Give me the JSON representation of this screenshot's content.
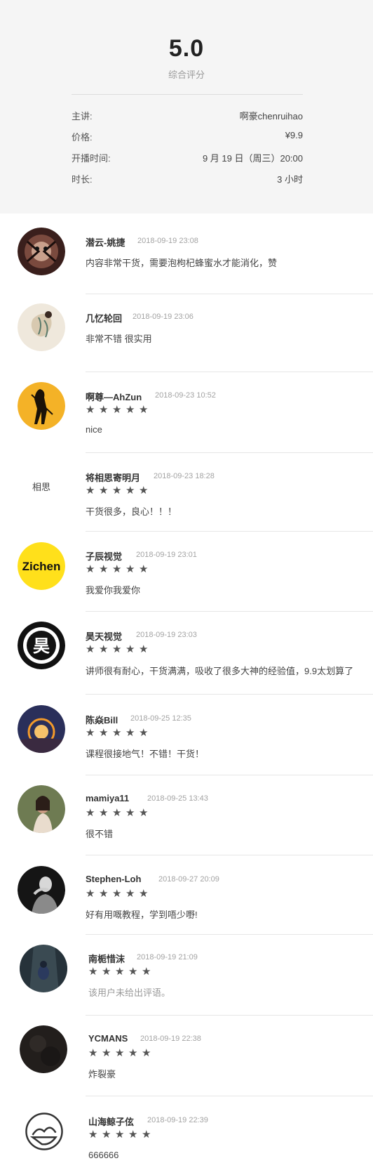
{
  "summary": {
    "score": "5.0",
    "score_label": "综合评分",
    "rows": [
      {
        "key": "主讲:",
        "value": "啊豪chenruihao"
      },
      {
        "key": "价格:",
        "value": "¥9.9"
      },
      {
        "key": "开播时间:",
        "value": "9 月 19 日（周三）20:00"
      },
      {
        "key": "时长:",
        "value": "3 小时"
      }
    ]
  },
  "stars_glyph": "★★★★★",
  "reviews": [
    {
      "name": "潜云-姚捷",
      "time": "2018-09-19 23:08",
      "text": "内容非常干货，需要泡枸杞蜂蜜水才能消化，赞",
      "stars": 0
    },
    {
      "name": "几忆轮回",
      "time": "2018-09-19 23:06",
      "text": "非常不错 很实用",
      "stars": 0
    },
    {
      "name": "啊尊—AhZun",
      "time": "2018-09-23 10:52",
      "text": "nice",
      "stars": 5
    },
    {
      "name": "将相思寄明月",
      "time": "2018-09-23 18:28",
      "text": "干货很多，良心！！！",
      "stars": 5
    },
    {
      "name": "子辰视觉",
      "time": "2018-09-19 23:01",
      "text": "我爱你我爱你",
      "stars": 5
    },
    {
      "name": "昊天视觉",
      "time": "2018-09-19 23:03",
      "text": "讲师很有耐心，干货满满，吸收了很多大神的经验值，9.9太划算了",
      "stars": 5
    },
    {
      "name": "陈焱Bill",
      "time": "2018-09-25 12:35",
      "text": "课程很接地气！不错！干货！",
      "stars": 5
    },
    {
      "name": "mamiya11",
      "time": "2018-09-25 13:43",
      "text": "很不错",
      "stars": 5
    },
    {
      "name": "Stephen-Loh",
      "time": "2018-09-27 20:09",
      "text": "好有用嘅教程，学到唔少嘢!",
      "stars": 5
    },
    {
      "name": "南栀惜沫",
      "time": "2018-09-19 21:09",
      "text": "该用户未给出评语。",
      "stars": 5,
      "muted": true
    },
    {
      "name": "YCMANS",
      "time": "2018-09-19 22:38",
      "text": "炸裂豪",
      "stars": 5
    },
    {
      "name": "山海鲸子伭",
      "time": "2018-09-19 22:39",
      "text": "666666",
      "stars": 5
    }
  ],
  "avatars": {
    "zichen_logo_text": "Zichen",
    "jiangxiang_calligraphy": "相思",
    "haotian_logo_text": "昊"
  },
  "colors": {
    "summary_bg": "#f5f5f5",
    "star": "#555555",
    "time": "#a3a3a3",
    "zichen_yellow": "#ffe01b",
    "ahzun_orange": "#f4b227"
  }
}
